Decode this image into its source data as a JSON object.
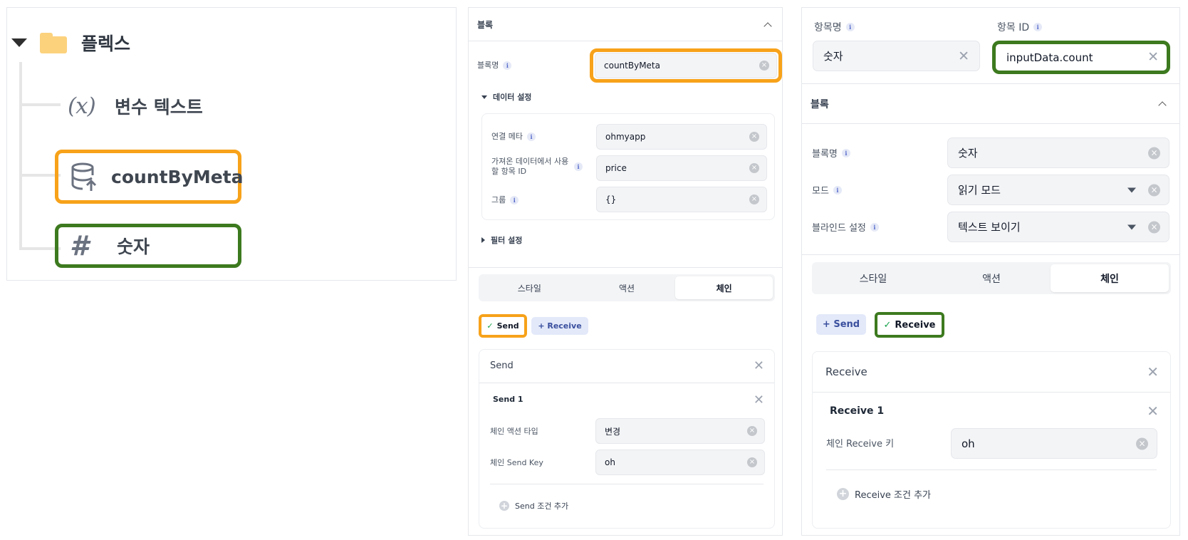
{
  "tree": {
    "root_label": "플렉스",
    "items": [
      {
        "icon": "variable-icon",
        "icon_text": "(x)",
        "label": "변수 텍스트"
      },
      {
        "icon": "database-upload-icon",
        "label": "countByMeta"
      },
      {
        "icon": "hash-icon",
        "icon_text": "#",
        "label": "숫자"
      }
    ]
  },
  "mid": {
    "block_section": "블록",
    "block_name_label": "블록명",
    "block_name_value": "countByMeta",
    "data_settings": "데이터 설정",
    "linked_meta_label": "연결 메타",
    "linked_meta_value": "ohmyapp",
    "field_id_label": "가져온 데이터에서 사용할 항목 ID",
    "field_id_value": "price",
    "group_label": "그룹",
    "group_value": "{}",
    "filter_settings": "필터 설정",
    "tabs": [
      "스타일",
      "액션",
      "체인"
    ],
    "send_chip": "Send",
    "receive_chip": "+ Receive",
    "send_card_title": "Send",
    "send1_title": "Send 1",
    "chain_action_type_label": "체인 액션 타입",
    "chain_action_type_value": "변경",
    "chain_send_key_label": "체인 Send Key",
    "chain_send_key_value": "oh",
    "add_condition": "Send 조건 추가"
  },
  "right": {
    "item_name_label": "항목명",
    "item_name_value": "숫자",
    "item_id_label": "항목 ID",
    "item_id_value": "inputData.count",
    "block_section": "블록",
    "block_name_label": "블록명",
    "block_name_value": "숫자",
    "mode_label": "모드",
    "mode_value": "읽기 모드",
    "blind_label": "블라인드 설정",
    "blind_value": "텍스트 보이기",
    "tabs": [
      "스타일",
      "액션",
      "체인"
    ],
    "send_chip": "+ Send",
    "receive_chip": "Receive",
    "receive_card_title": "Receive",
    "receive1_title": "Receive 1",
    "chain_receive_key_label": "체인 Receive 키",
    "chain_receive_key_value": "oh",
    "add_condition": "Receive 조건 추가"
  },
  "colors": {
    "highlight_orange": "#f7a21a",
    "highlight_green": "#3d7a1f",
    "folder": "#fcd27d",
    "chip_blue_bg": "#e3e9f9"
  }
}
